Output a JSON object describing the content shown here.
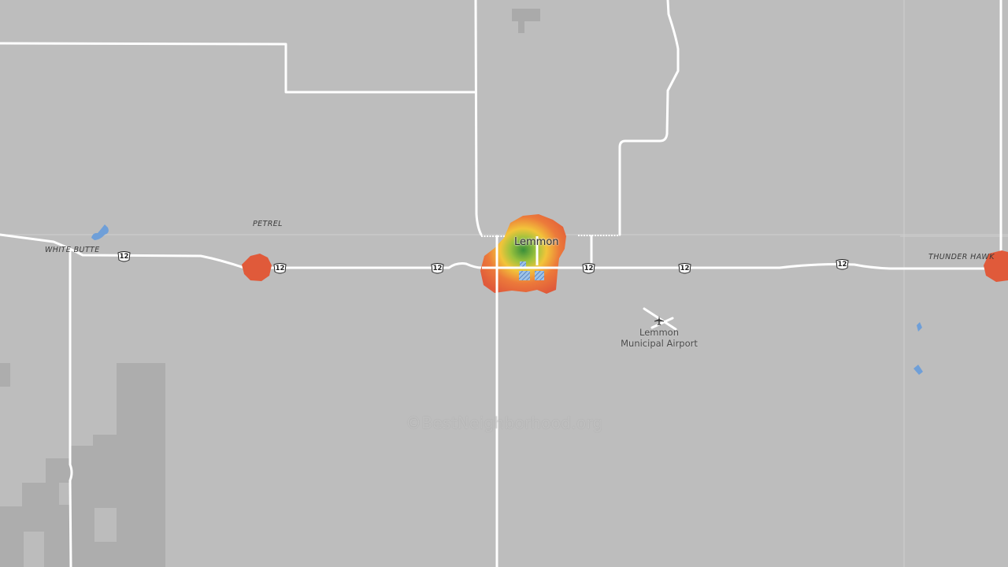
{
  "map": {
    "places": {
      "lemmon": "Lemmon",
      "petrel": "PETREL",
      "white_butte": "WHITE BUTTE",
      "thunder_hawk": "THUNDER HAWK"
    },
    "airport": {
      "line1": "Lemmon",
      "line2": "Municipal Airport",
      "icon": "airplane-icon"
    },
    "highway_shields": [
      "12",
      "12",
      "12",
      "12",
      "12",
      "12"
    ],
    "watermark": "©BestNeighborhood.org",
    "colors": {
      "background": "#bdbdbd",
      "roads": "#ffffff",
      "water": "#6f9fd8",
      "heat_low": "#e05a3a",
      "heat_mid": "#f2c43a",
      "heat_high": "#3a8f3a"
    }
  }
}
